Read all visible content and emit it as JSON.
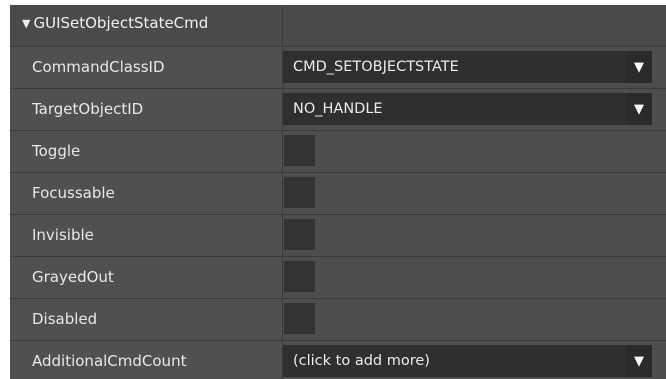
{
  "group": {
    "expand_glyph": "▼",
    "title": "GUISetObjectStateCmd"
  },
  "properties": [
    {
      "label": "CommandClassID",
      "type": "dropdown",
      "value": "CMD_SETOBJECTSTATE"
    },
    {
      "label": "TargetObjectID",
      "type": "dropdown",
      "value": "NO_HANDLE"
    },
    {
      "label": "Toggle",
      "type": "checkbox",
      "checked": false
    },
    {
      "label": "Focussable",
      "type": "checkbox",
      "checked": false
    },
    {
      "label": "Invisible",
      "type": "checkbox",
      "checked": false
    },
    {
      "label": "GrayedOut",
      "type": "checkbox",
      "checked": false
    },
    {
      "label": "Disabled",
      "type": "checkbox",
      "checked": false
    },
    {
      "label": "AdditionalCmdCount",
      "type": "dropdown",
      "value": "(click to add more)"
    }
  ],
  "dropdown_arrow_glyph": "▼",
  "colors": {
    "panel_bg": "#3a3a3a",
    "label_cell": "#505050",
    "value_cell": "#4d4d4d",
    "field_bg": "#2f2f2f",
    "text": "#e8e8e8"
  }
}
